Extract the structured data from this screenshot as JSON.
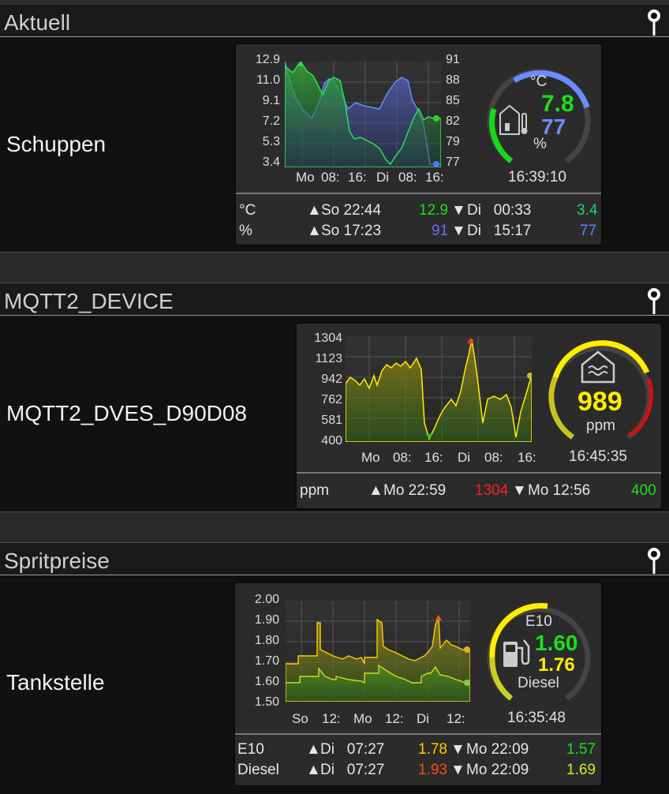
{
  "sections": [
    {
      "title": "Aktuell",
      "device": "Schuppen",
      "chart": {
        "yleft_ticks": [
          "12.9",
          "11.0",
          "9.1",
          "7.2",
          "5.3",
          "3.4"
        ],
        "yright_ticks": [
          "91",
          "88",
          "85",
          "82",
          "79",
          "77"
        ],
        "x_labels": [
          "Mo",
          "08:",
          "16:",
          "Di",
          "08:",
          "16:"
        ]
      },
      "gauge": {
        "unit_top": "°C",
        "value1": "7.8",
        "value2": "77",
        "unit_bottom": "%",
        "time": "16:39:10",
        "icon": "house-thermometer-icon"
      },
      "stats": [
        {
          "label": "°C",
          "max_time": "So 22:44",
          "max": "12.9",
          "min_time": "Di   00:33",
          "min": "3.4"
        },
        {
          "label": "%",
          "max_time": "So 17:23",
          "max": "91",
          "min_time": "Di   15:17",
          "min": "77"
        }
      ]
    },
    {
      "title": "MQTT2_DEVICE",
      "device": "MQTT2_DVES_D90D08",
      "chart": {
        "yleft_ticks": [
          "1304",
          "1123",
          "942",
          "762",
          "581",
          "400"
        ],
        "x_labels": [
          "Mo",
          "08:",
          "16:",
          "Di",
          "08:",
          "16:"
        ]
      },
      "gauge": {
        "value": "989",
        "unit": "ppm",
        "time": "16:45:35",
        "icon": "house-air-quality-icon"
      },
      "stats": [
        {
          "label": "ppm",
          "max_time": "Mo 22:59",
          "max": "1304",
          "min_time": "Mo 12:56",
          "min": "400"
        }
      ]
    },
    {
      "title": "Spritpreise",
      "device": "Tankstelle",
      "chart": {
        "yleft_ticks": [
          "2.00",
          "1.90",
          "1.80",
          "1.70",
          "1.60",
          "1.50"
        ],
        "x_labels": [
          "So",
          "12:",
          "Mo",
          "12:",
          "Di",
          "12:"
        ]
      },
      "gauge": {
        "label_top": "E10",
        "value1": "1.60",
        "value2": "1.76",
        "label_bottom": "Diesel",
        "time": "16:35:48",
        "icon": "fuel-pump-icon"
      },
      "stats": [
        {
          "label": "E10",
          "max_time": "Di   07:27",
          "max": "1.78",
          "min_time": "Mo 22:09",
          "min": "1.57"
        },
        {
          "label": "Diesel",
          "max_time": "Di   07:27",
          "max": "1.93",
          "min_time": "Mo 22:09",
          "min": "1.69"
        }
      ]
    }
  ],
  "symbols": {
    "up": "▲",
    "down": "▼"
  },
  "colors": {
    "green": "#19d819",
    "blue": "#6a8cff",
    "yellow": "#ffee00",
    "red": "#ff2020",
    "orange": "#ff6600"
  }
}
